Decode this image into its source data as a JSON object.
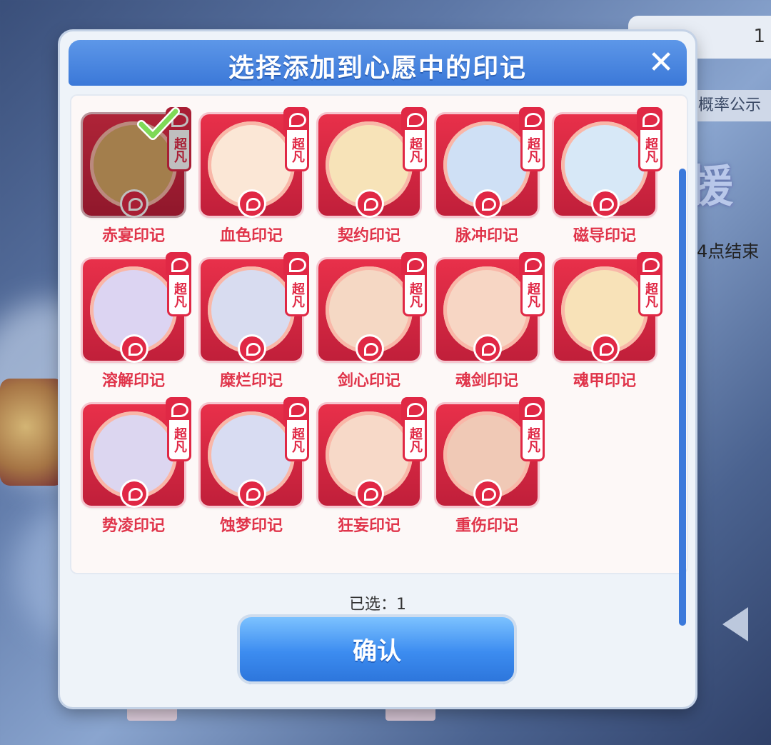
{
  "background": {
    "count_value": "1",
    "probability_label": "概率公示",
    "logo_text": "援",
    "event_end_text": "4点结束"
  },
  "dialog": {
    "title": "选择添加到心愿中的印记",
    "rarity_badge": "超凡",
    "selected_text": "已选：1",
    "confirm_label": "确认",
    "items": [
      {
        "label": "赤宴印记",
        "selected": true
      },
      {
        "label": "血色印记",
        "selected": false
      },
      {
        "label": "契约印记",
        "selected": false
      },
      {
        "label": "脉冲印记",
        "selected": false
      },
      {
        "label": "磁导印记",
        "selected": false
      },
      {
        "label": "溶解印记",
        "selected": false
      },
      {
        "label": "糜烂印记",
        "selected": false
      },
      {
        "label": "剑心印记",
        "selected": false
      },
      {
        "label": "魂剑印记",
        "selected": false
      },
      {
        "label": "魂甲印记",
        "selected": false
      },
      {
        "label": "势凌印记",
        "selected": false
      },
      {
        "label": "蚀梦印记",
        "selected": false
      },
      {
        "label": "狂妄印记",
        "selected": false
      },
      {
        "label": "重伤印记",
        "selected": false
      }
    ]
  },
  "colors": {
    "accent_red": "#e02845",
    "title_blue": "#3b78d8",
    "confirm_blue": "#3c8cf0",
    "check_green": "#7ed957"
  }
}
